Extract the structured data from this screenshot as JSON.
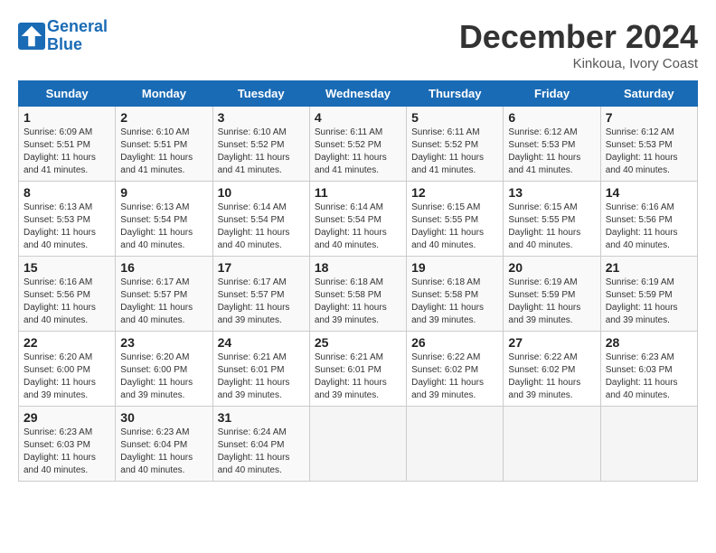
{
  "header": {
    "logo_line1": "General",
    "logo_line2": "Blue",
    "month": "December 2024",
    "location": "Kinkoua, Ivory Coast"
  },
  "days_of_week": [
    "Sunday",
    "Monday",
    "Tuesday",
    "Wednesday",
    "Thursday",
    "Friday",
    "Saturday"
  ],
  "weeks": [
    [
      {
        "day": "1",
        "info": "Sunrise: 6:09 AM\nSunset: 5:51 PM\nDaylight: 11 hours and 41 minutes."
      },
      {
        "day": "2",
        "info": "Sunrise: 6:10 AM\nSunset: 5:51 PM\nDaylight: 11 hours and 41 minutes."
      },
      {
        "day": "3",
        "info": "Sunrise: 6:10 AM\nSunset: 5:52 PM\nDaylight: 11 hours and 41 minutes."
      },
      {
        "day": "4",
        "info": "Sunrise: 6:11 AM\nSunset: 5:52 PM\nDaylight: 11 hours and 41 minutes."
      },
      {
        "day": "5",
        "info": "Sunrise: 6:11 AM\nSunset: 5:52 PM\nDaylight: 11 hours and 41 minutes."
      },
      {
        "day": "6",
        "info": "Sunrise: 6:12 AM\nSunset: 5:53 PM\nDaylight: 11 hours and 41 minutes."
      },
      {
        "day": "7",
        "info": "Sunrise: 6:12 AM\nSunset: 5:53 PM\nDaylight: 11 hours and 40 minutes."
      }
    ],
    [
      {
        "day": "8",
        "info": "Sunrise: 6:13 AM\nSunset: 5:53 PM\nDaylight: 11 hours and 40 minutes."
      },
      {
        "day": "9",
        "info": "Sunrise: 6:13 AM\nSunset: 5:54 PM\nDaylight: 11 hours and 40 minutes."
      },
      {
        "day": "10",
        "info": "Sunrise: 6:14 AM\nSunset: 5:54 PM\nDaylight: 11 hours and 40 minutes."
      },
      {
        "day": "11",
        "info": "Sunrise: 6:14 AM\nSunset: 5:54 PM\nDaylight: 11 hours and 40 minutes."
      },
      {
        "day": "12",
        "info": "Sunrise: 6:15 AM\nSunset: 5:55 PM\nDaylight: 11 hours and 40 minutes."
      },
      {
        "day": "13",
        "info": "Sunrise: 6:15 AM\nSunset: 5:55 PM\nDaylight: 11 hours and 40 minutes."
      },
      {
        "day": "14",
        "info": "Sunrise: 6:16 AM\nSunset: 5:56 PM\nDaylight: 11 hours and 40 minutes."
      }
    ],
    [
      {
        "day": "15",
        "info": "Sunrise: 6:16 AM\nSunset: 5:56 PM\nDaylight: 11 hours and 40 minutes."
      },
      {
        "day": "16",
        "info": "Sunrise: 6:17 AM\nSunset: 5:57 PM\nDaylight: 11 hours and 40 minutes."
      },
      {
        "day": "17",
        "info": "Sunrise: 6:17 AM\nSunset: 5:57 PM\nDaylight: 11 hours and 39 minutes."
      },
      {
        "day": "18",
        "info": "Sunrise: 6:18 AM\nSunset: 5:58 PM\nDaylight: 11 hours and 39 minutes."
      },
      {
        "day": "19",
        "info": "Sunrise: 6:18 AM\nSunset: 5:58 PM\nDaylight: 11 hours and 39 minutes."
      },
      {
        "day": "20",
        "info": "Sunrise: 6:19 AM\nSunset: 5:59 PM\nDaylight: 11 hours and 39 minutes."
      },
      {
        "day": "21",
        "info": "Sunrise: 6:19 AM\nSunset: 5:59 PM\nDaylight: 11 hours and 39 minutes."
      }
    ],
    [
      {
        "day": "22",
        "info": "Sunrise: 6:20 AM\nSunset: 6:00 PM\nDaylight: 11 hours and 39 minutes."
      },
      {
        "day": "23",
        "info": "Sunrise: 6:20 AM\nSunset: 6:00 PM\nDaylight: 11 hours and 39 minutes."
      },
      {
        "day": "24",
        "info": "Sunrise: 6:21 AM\nSunset: 6:01 PM\nDaylight: 11 hours and 39 minutes."
      },
      {
        "day": "25",
        "info": "Sunrise: 6:21 AM\nSunset: 6:01 PM\nDaylight: 11 hours and 39 minutes."
      },
      {
        "day": "26",
        "info": "Sunrise: 6:22 AM\nSunset: 6:02 PM\nDaylight: 11 hours and 39 minutes."
      },
      {
        "day": "27",
        "info": "Sunrise: 6:22 AM\nSunset: 6:02 PM\nDaylight: 11 hours and 39 minutes."
      },
      {
        "day": "28",
        "info": "Sunrise: 6:23 AM\nSunset: 6:03 PM\nDaylight: 11 hours and 40 minutes."
      }
    ],
    [
      {
        "day": "29",
        "info": "Sunrise: 6:23 AM\nSunset: 6:03 PM\nDaylight: 11 hours and 40 minutes."
      },
      {
        "day": "30",
        "info": "Sunrise: 6:23 AM\nSunset: 6:04 PM\nDaylight: 11 hours and 40 minutes."
      },
      {
        "day": "31",
        "info": "Sunrise: 6:24 AM\nSunset: 6:04 PM\nDaylight: 11 hours and 40 minutes."
      },
      {
        "day": "",
        "info": ""
      },
      {
        "day": "",
        "info": ""
      },
      {
        "day": "",
        "info": ""
      },
      {
        "day": "",
        "info": ""
      }
    ]
  ]
}
